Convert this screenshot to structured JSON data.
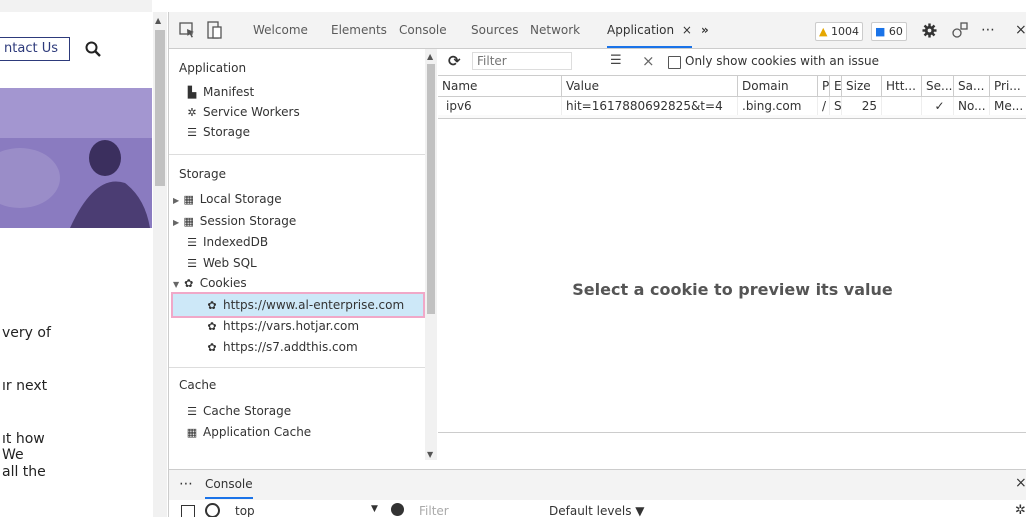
{
  "page": {
    "contact_label": "ntact Us",
    "paragraphs": [
      "very of",
      "ır next",
      "ıt how",
      "We",
      "all the"
    ]
  },
  "devtools": {
    "tabs": [
      "Welcome",
      "Elements",
      "Console",
      "Sources",
      "Network",
      "Application"
    ],
    "active_tab_close": "×",
    "more_tabs": "»",
    "warnings_count": "1004",
    "messages_count": "60",
    "more_menu": "⋯",
    "close_devtools": "×"
  },
  "sidebar": {
    "application_header": "Application",
    "application_items": [
      "Manifest",
      "Service Workers",
      "Storage"
    ],
    "storage_header": "Storage",
    "storage_items": [
      "Local Storage",
      "Session Storage",
      "IndexedDB",
      "Web SQL",
      "Cookies"
    ],
    "cookie_origins": [
      "https://www.al-enterprise.com",
      "https://vars.hotjar.com",
      "https://s7.addthis.com"
    ],
    "cache_header": "Cache",
    "cache_items": [
      "Cache Storage",
      "Application Cache"
    ]
  },
  "toolbar": {
    "filter_placeholder": "Filter",
    "clear_label": "×",
    "only_issues_label": "Only show cookies with an issue"
  },
  "cookie_table": {
    "columns": [
      "Name",
      "Value",
      "Domain",
      "P",
      "E.",
      "Size",
      "Htt...",
      "Se...",
      "Sa...",
      "Pri..."
    ],
    "rows": [
      [
        "ipv6",
        "hit=1617880692825&t=4",
        ".bing.com",
        "/",
        "S.",
        "25",
        "",
        "✓",
        "No...",
        "Me..."
      ]
    ]
  },
  "preview_message": "Select a cookie to preview its value",
  "drawer": {
    "more": "⋯",
    "tab_console": "Console",
    "close": "×",
    "context": "top",
    "filter_placeholder": "Filter",
    "levels": "Default levels ▼"
  },
  "colors": {
    "accent": "#1a73e8",
    "selection": "#cde8f8",
    "highlight_outline": "#f0a8c8",
    "hero": "#8a7bc0"
  }
}
